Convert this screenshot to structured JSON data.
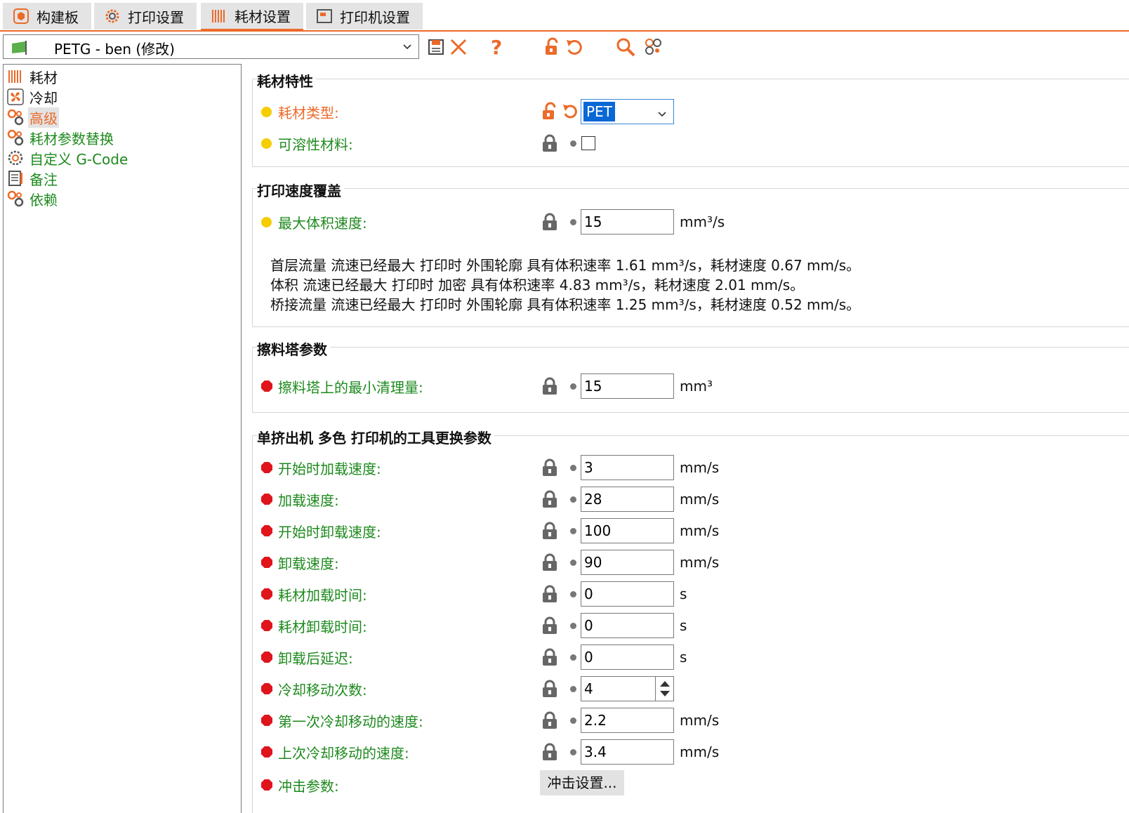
{
  "tabs": [
    {
      "label": "构建板",
      "icon": "plater-icon"
    },
    {
      "label": "打印设置",
      "icon": "gear-icon"
    },
    {
      "label": "耗材设置",
      "icon": "spool-icon"
    },
    {
      "label": "打印机设置",
      "icon": "printer-icon"
    }
  ],
  "active_tab": "耗材设置",
  "preset": {
    "value": "PETG - ben (修改)"
  },
  "tree": [
    {
      "label": "耗材",
      "icon": "spool-icon"
    },
    {
      "label": "冷却",
      "icon": "fan-icon"
    },
    {
      "label": "高级",
      "icon": "wrench-icon"
    },
    {
      "label": "耗材参数替换",
      "icon": "wrench-icon"
    },
    {
      "label": "自定义 G-Code",
      "icon": "gear-icon"
    },
    {
      "label": "备注",
      "icon": "notes-icon"
    },
    {
      "label": "依赖",
      "icon": "wrench-icon"
    }
  ],
  "selected_tree_item": "高级",
  "colors": {
    "accent": "#ec6a2a",
    "label_green": "#1e8a1e",
    "simple_mode": "#f5cd00",
    "expert_mode": "#e0141c"
  },
  "groups": {
    "filament_props": {
      "title": "耗材特性",
      "type": {
        "label": "耗材类型:",
        "value": "PET"
      },
      "soluble": {
        "label": "可溶性材料:",
        "checked": false
      }
    },
    "speed_override": {
      "title": "打印速度覆盖",
      "max_vol": {
        "label": "最大体积速度:",
        "value": "15",
        "unit": "mm³/s"
      },
      "info": [
        "首层流量 流速已经最大 打印时 外围轮廓 具有体积速率 1.61 mm³/s，耗材速度 0.67 mm/s。",
        "体积 流速已经最大 打印时 加密 具有体积速率 4.83 mm³/s，耗材速度 2.01 mm/s。",
        "桥接流量 流速已经最大 打印时 外围轮廓 具有体积速率 1.25 mm³/s，耗材速度 0.52 mm/s。"
      ]
    },
    "wipe_tower": {
      "title": "擦料塔参数",
      "min_purge": {
        "label": "擦料塔上的最小清理量:",
        "value": "15",
        "unit": "mm³"
      }
    },
    "toolchange": {
      "title": "单挤出机 多色 打印机的工具更换参数",
      "rows": [
        {
          "label": "开始时加载速度:",
          "value": "3",
          "unit": "mm/s"
        },
        {
          "label": "加载速度:",
          "value": "28",
          "unit": "mm/s"
        },
        {
          "label": "开始时卸载速度:",
          "value": "100",
          "unit": "mm/s"
        },
        {
          "label": "卸载速度:",
          "value": "90",
          "unit": "mm/s"
        },
        {
          "label": "耗材加载时间:",
          "value": "0",
          "unit": "s"
        },
        {
          "label": "耗材卸载时间:",
          "value": "0",
          "unit": "s"
        },
        {
          "label": "卸载后延迟:",
          "value": "0",
          "unit": "s"
        },
        {
          "label": "冷却移动次数:",
          "value": "4",
          "unit": ""
        },
        {
          "label": "第一次冷却移动的速度:",
          "value": "2.2",
          "unit": "mm/s"
        },
        {
          "label": "上次冷却移动的速度:",
          "value": "3.4",
          "unit": "mm/s"
        }
      ],
      "ramming": {
        "label": "冲击参数:",
        "button": "冲击设置..."
      }
    }
  }
}
